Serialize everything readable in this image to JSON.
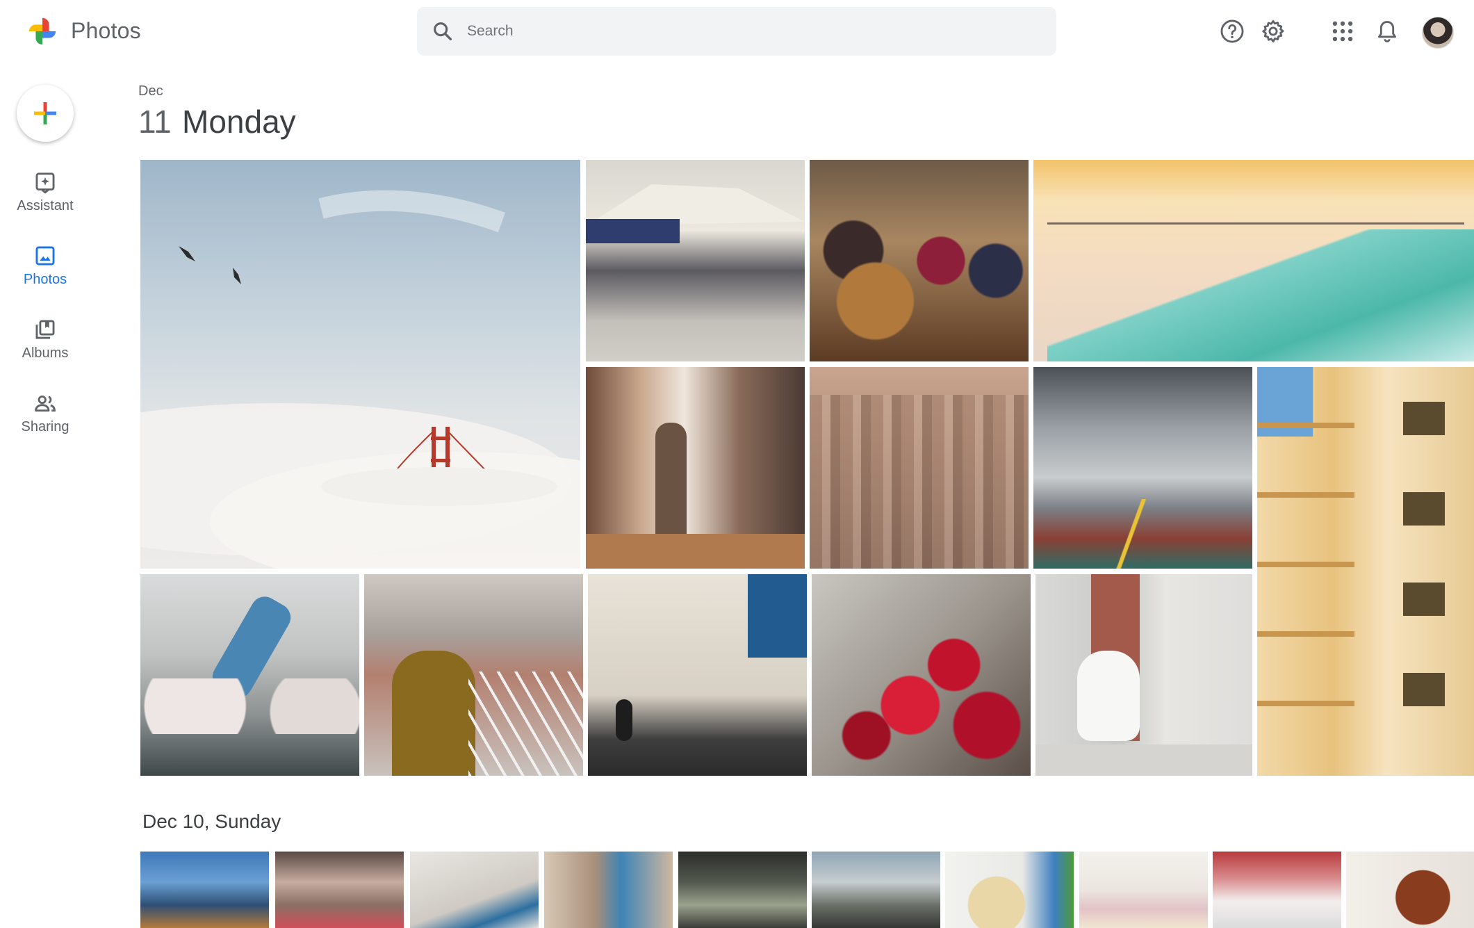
{
  "app": {
    "title": "Photos"
  },
  "search": {
    "placeholder": "Search"
  },
  "header_icons": [
    "help-icon",
    "settings-icon",
    "apps-grid-icon",
    "notifications-bell-icon",
    "account-avatar"
  ],
  "colors": {
    "accent": "#1a73e8",
    "text": "#3c4043",
    "muted": "#5f6368",
    "search_bg": "#f1f3f4"
  },
  "sidebar": {
    "create_button": "plus-icon",
    "items": [
      {
        "label": "Assistant",
        "icon": "assistant-icon",
        "active": false
      },
      {
        "label": "Photos",
        "icon": "photos-icon",
        "active": true
      },
      {
        "label": "Albums",
        "icon": "albums-icon",
        "active": false
      },
      {
        "label": "Sharing",
        "icon": "sharing-icon",
        "active": false
      }
    ]
  },
  "sections": [
    {
      "month": "Dec",
      "day_number": "11",
      "day_name": "Monday",
      "photos": [
        {
          "name": "photo-golden-gate-fog"
        },
        {
          "name": "photo-market-musician"
        },
        {
          "name": "photo-dried-fruit-stall"
        },
        {
          "name": "photo-escalator-building"
        },
        {
          "name": "photo-bookstore-man"
        },
        {
          "name": "photo-city-skyline"
        },
        {
          "name": "photo-bike-lane-bridge"
        },
        {
          "name": "photo-yellow-apartment-balconies"
        },
        {
          "name": "photo-breakdancer-jump"
        },
        {
          "name": "photo-person-overlooking-city"
        },
        {
          "name": "photo-street-wall-shadow"
        },
        {
          "name": "photo-red-flowers"
        },
        {
          "name": "photo-white-cat-window"
        }
      ]
    },
    {
      "title": "Dec 10, Sunday",
      "photos": [
        {
          "name": "thumb-hands-skyscrapers"
        },
        {
          "name": "thumb-market-crowd"
        },
        {
          "name": "thumb-bird-mural"
        },
        {
          "name": "thumb-street-doorway"
        },
        {
          "name": "thumb-night-street-lamp"
        },
        {
          "name": "thumb-street-scooter"
        },
        {
          "name": "thumb-noodle-soup"
        },
        {
          "name": "thumb-dessert-plate"
        },
        {
          "name": "thumb-smoking-dish"
        },
        {
          "name": "thumb-grilled-meat"
        }
      ]
    }
  ]
}
